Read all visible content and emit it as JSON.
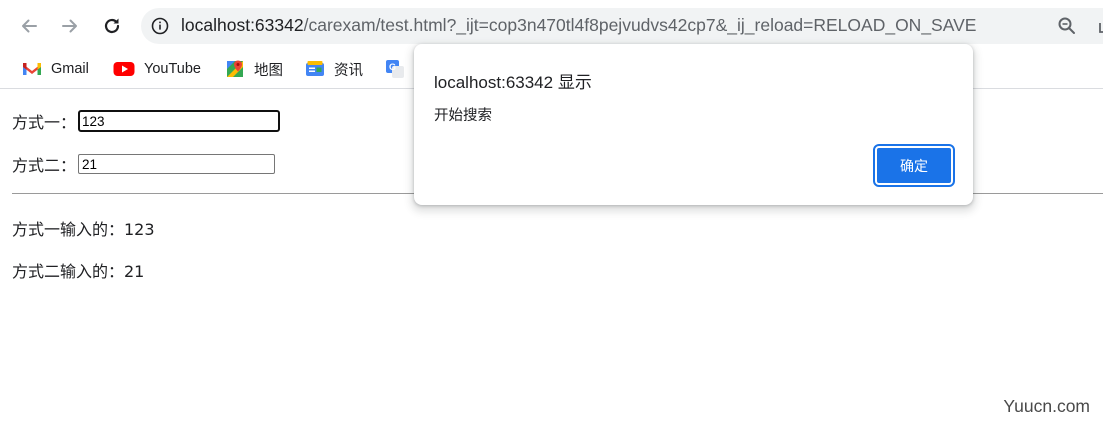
{
  "browser": {
    "url_host": "localhost:63342",
    "url_path": "/carexam/test.html?_ijt=cop3n470tl4f8pejvudvs42cp7&_ij_reload=RELOAD_ON_SAVE"
  },
  "bookmarks": [
    {
      "label": "Gmail",
      "icon": "gmail-icon"
    },
    {
      "label": "YouTube",
      "icon": "youtube-icon"
    },
    {
      "label": "地图",
      "icon": "maps-icon"
    },
    {
      "label": "资讯",
      "icon": "news-icon"
    },
    {
      "label": "",
      "icon": "translate-icon"
    }
  ],
  "form": {
    "method1_label": "方式一：",
    "method1_value": "123",
    "method2_label": "方式二：",
    "method2_value": "21"
  },
  "output": {
    "method1_text": "方式一输入的：123",
    "method2_text": "方式二输入的：21"
  },
  "dialog": {
    "title": "localhost:63342 显示",
    "message": "开始搜索",
    "ok_label": "确定"
  },
  "watermark": "Yuucn.com",
  "colors": {
    "accent": "#1a73e8",
    "omnibox_bg": "#f1f3f4",
    "youtube_red": "#ff0000"
  }
}
